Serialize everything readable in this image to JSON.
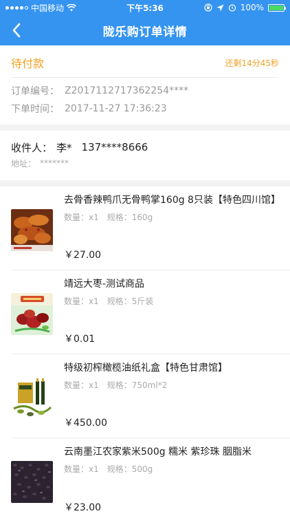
{
  "status_bar": {
    "carrier": "中国移动",
    "time": "下午5:36",
    "battery": "100%"
  },
  "nav": {
    "title": "陇乐购订单详情",
    "back_icon": "chevron-left-icon"
  },
  "order": {
    "status": "待付款",
    "countdown": "还剩14分45秒",
    "number_label": "订单编号：",
    "number_value": "Z2017112717362254****",
    "time_label": "下单时间：",
    "time_value": "2017-11-27 17:36:23"
  },
  "receiver": {
    "name_label": "收件人：",
    "name": "李*",
    "phone": "137****8666",
    "address_label": "地址：",
    "address": "*******"
  },
  "products": [
    {
      "name": "去骨香辣鸭爪无骨鸭掌160g 8只装【特色四川馆】",
      "qty_label": "数量：",
      "qty": "x1",
      "spec_label": "规格：",
      "spec": "160g",
      "price": "￥27.00"
    },
    {
      "name": "靖远大枣-测试商品",
      "qty_label": "数量：",
      "qty": "x1",
      "spec_label": "规格：",
      "spec": "5斤装",
      "price": "￥0.01"
    },
    {
      "name": "特级初榨橄榄油纸礼盒【特色甘肃馆】",
      "qty_label": "数量：",
      "qty": "x1",
      "spec_label": "规格：",
      "spec": "750ml*2",
      "price": "￥450.00"
    },
    {
      "name": "云南墨江农家紫米500g 糯米 紫珍珠 胭脂米",
      "qty_label": "数量：",
      "qty": "x1",
      "spec_label": "规格：",
      "spec": "500g",
      "price": "￥23.00"
    }
  ],
  "colors": {
    "primary": "#3594f0",
    "pending": "#f0a020",
    "battery": "#4cd964"
  }
}
